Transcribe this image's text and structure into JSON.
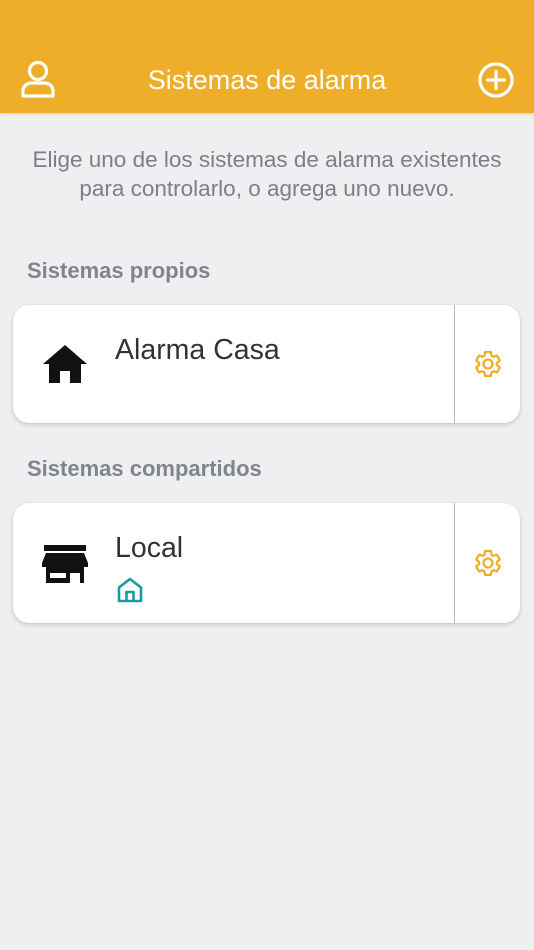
{
  "header": {
    "title": "Sistemas de alarma",
    "user_icon": "user-icon",
    "add_icon": "add-circle-icon",
    "background": "#efae29"
  },
  "intro": {
    "text": "Elige uno de los sistemas de alarma existentes para controlarlo, o agrega uno nuevo."
  },
  "own_systems": {
    "section_title": "Sistemas propios",
    "items": [
      {
        "name": "Alarma Casa",
        "type_icon": "house-icon",
        "settings_icon": "gear-icon"
      }
    ]
  },
  "shared_systems": {
    "section_title": "Sistemas compartidos",
    "items": [
      {
        "name": "Local",
        "type_icon": "store-icon",
        "badge_icon": "home-outline-icon",
        "settings_icon": "gear-icon"
      }
    ]
  },
  "colors": {
    "accent": "#efae29",
    "background": "#efeff1",
    "badge": "#1a9aa3",
    "muted_text": "#7b7f87"
  }
}
